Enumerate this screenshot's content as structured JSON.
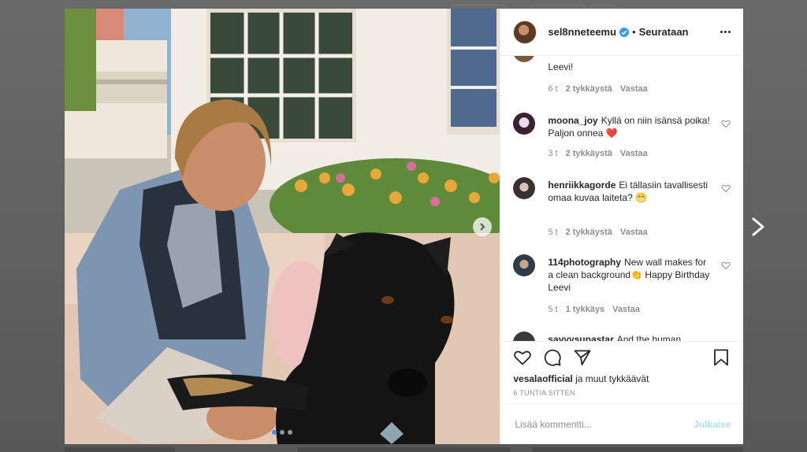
{
  "header": {
    "username": "sel8nneteemu",
    "separator": "•",
    "follow_state": "Seurataan",
    "verified_icon": "verified-badge-icon",
    "more_icon": "more-options-icon"
  },
  "comments": [
    {
      "username": "",
      "text": "Leevi!",
      "time": "6 t",
      "likes": "2 tykkäystä",
      "reply": "Vastaa"
    },
    {
      "username": "moona_joy",
      "text": "Kyllä on niin isänsä poika! Paljon onnea ❤️",
      "time": "3 t",
      "likes": "2 tykkäystä",
      "reply": "Vastaa"
    },
    {
      "username": "henriikkagorde",
      "text": "Ei tällasiin tavallisesti omaa kuvaa laiteta? 😁",
      "time": "5 t",
      "likes": "2 tykkäystä",
      "reply": "Vastaa"
    },
    {
      "username": "114photography",
      "text": "New wall makes for a clean background👏 Happy Birthday Leevi",
      "time": "5 t",
      "likes": "1 tykkäys",
      "reply": "Vastaa"
    },
    {
      "username": "savvysupastar",
      "text": "And the human"
    }
  ],
  "likes": {
    "user": "vesalaofficial",
    "rest": " ja muut tykkäävät"
  },
  "timestamp": "6 tuntia sitten",
  "add_comment": {
    "placeholder": "Lisää kommentti...",
    "post_label": "Julkaise"
  },
  "carousel": {
    "total": 3,
    "active_index": 1
  },
  "colors": {
    "accent": "#3897f0",
    "post_disabled": "#b2dffc",
    "text": "#262626",
    "muted": "#8e8e8e",
    "overlay": "#5f5f5f"
  }
}
